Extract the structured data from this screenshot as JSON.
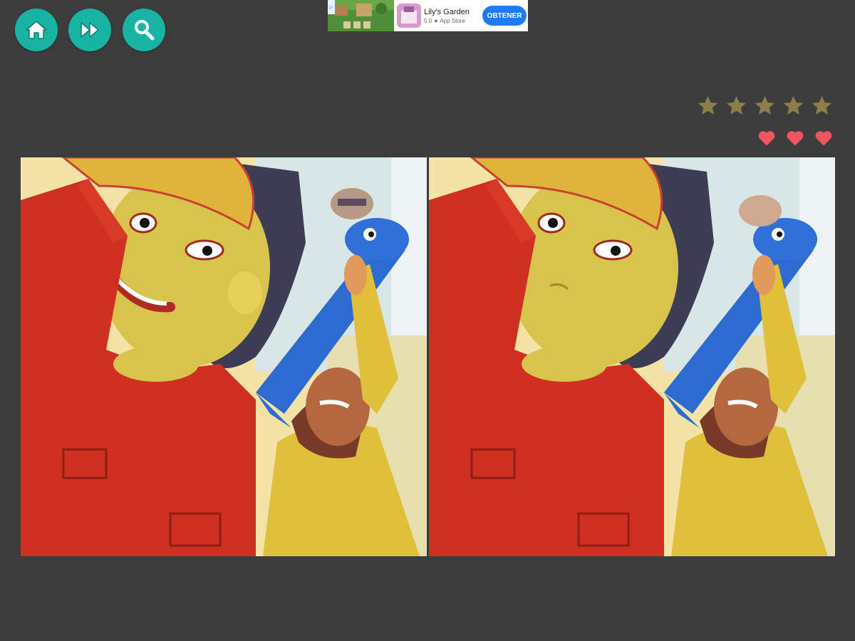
{
  "toolbar": {
    "buttons": [
      {
        "name": "home",
        "icon": "house-icon"
      },
      {
        "name": "skip",
        "icon": "fast-forward-icon"
      },
      {
        "name": "hint",
        "icon": "magnifier-icon"
      }
    ],
    "button_color": "#17b3a3"
  },
  "ad": {
    "title": "Lily's Garden",
    "subtitle": "5.0 ★ App Store",
    "cta_label": "OBTENER",
    "cta_color": "#1f7af7"
  },
  "score": {
    "stars_total": 5,
    "stars_earned": 0,
    "star_color": "#8a7f4a",
    "lives_total": 3,
    "lives_remaining": 3,
    "heart_color": "#f25560"
  },
  "puzzle": {
    "panels": [
      "original-image",
      "modified-image"
    ]
  }
}
